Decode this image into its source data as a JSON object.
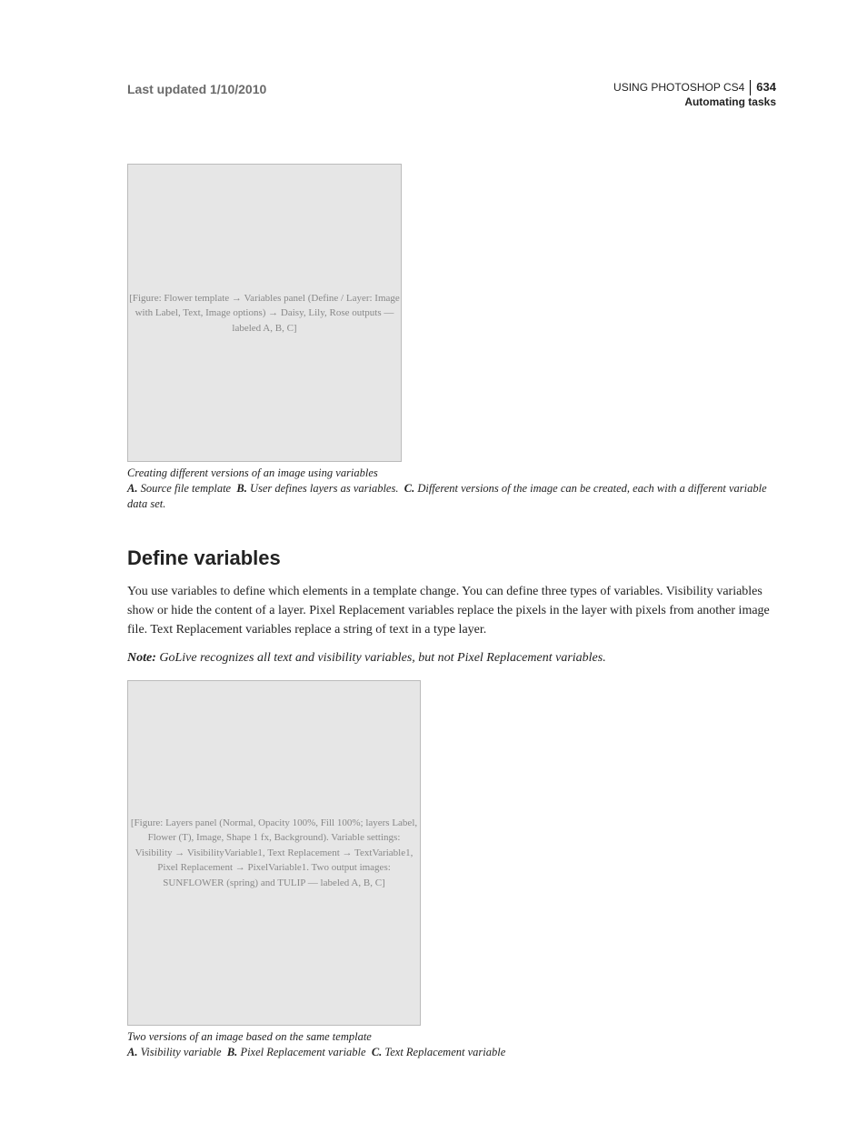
{
  "header": {
    "last_updated": "Last updated 1/10/2010",
    "product": "USING PHOTOSHOP CS4",
    "page_number": "634",
    "chapter": "Automating tasks"
  },
  "figure1": {
    "placeholder": "[Figure: Flower template → Variables panel (Define / Layer: Image with Label, Text, Image options) → Daisy, Lily, Rose outputs — labeled A, B, C]",
    "caption_main": "Creating different versions of an image using variables",
    "a_label": "A.",
    "a_text": "Source file template",
    "b_label": "B.",
    "b_text": "User defines layers as variables.",
    "c_label": "C.",
    "c_text": "Different versions of the image can be created, each with a different variable data set."
  },
  "section": {
    "heading": "Define variables",
    "para": "You use variables to define which elements in a template change. You can define three types of variables. Visibility variables show or hide the content of a layer. Pixel Replacement variables replace the pixels in the layer with pixels from another image file. Text Replacement variables replace a string of text in a type layer.",
    "note_label": "Note:",
    "note_text": " GoLive recognizes all text and visibility variables, but not Pixel Replacement variables."
  },
  "figure2": {
    "placeholder": "[Figure: Layers panel (Normal, Opacity 100%, Fill 100%; layers Label, Flower (T), Image, Shape 1 fx, Background). Variable settings: Visibility → VisibilityVariable1, Text Replacement → TextVariable1, Pixel Replacement → PixelVariable1. Two output images: SUNFLOWER (spring) and TULIP — labeled A, B, C]",
    "caption_main": "Two versions of an image based on the same template",
    "a_label": "A.",
    "a_text": "Visibility variable",
    "b_label": "B.",
    "b_text": "Pixel Replacement variable",
    "c_label": "C.",
    "c_text": "Text Replacement variable"
  }
}
